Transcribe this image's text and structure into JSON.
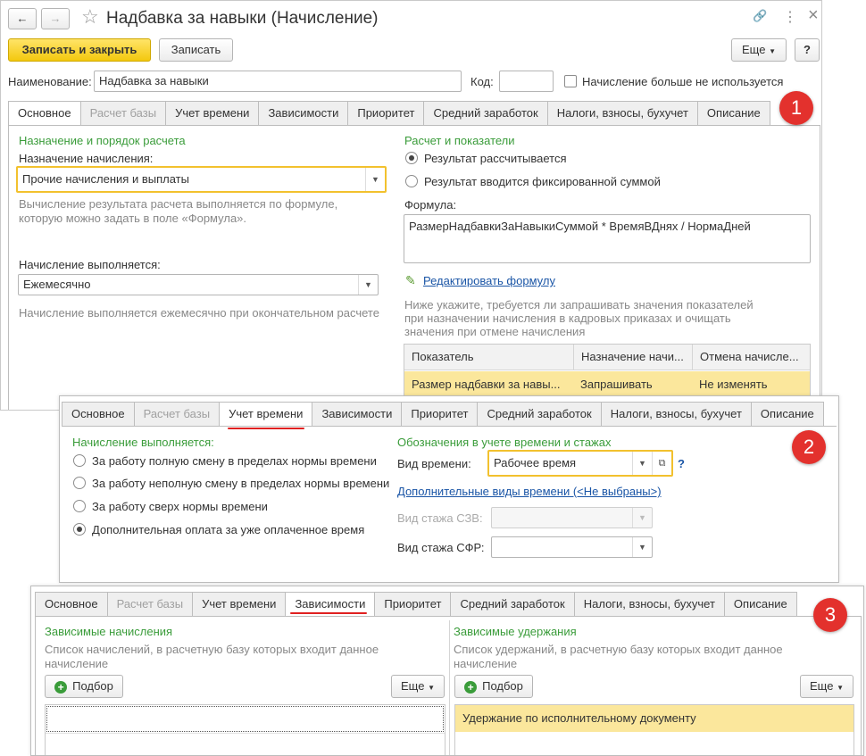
{
  "window": {
    "title": "Надбавка за навыки (Начисление)",
    "back_icon": "←",
    "forward_icon": "→",
    "star_icon": "☆",
    "link_icon": "🔗",
    "menu_icon": "⋮",
    "close_icon": "×"
  },
  "toolbar": {
    "save_close_label": "Записать и закрыть",
    "save_label": "Записать",
    "more_label": "Еще",
    "help_label": "?"
  },
  "header": {
    "name_label": "Наименование:",
    "name_value": "Надбавка за навыки",
    "code_label": "Код:",
    "code_value": "",
    "not_used_label": "Начисление больше не используется"
  },
  "tabs": [
    {
      "label": "Основное"
    },
    {
      "label": "Расчет базы"
    },
    {
      "label": "Учет времени"
    },
    {
      "label": "Зависимости"
    },
    {
      "label": "Приоритет"
    },
    {
      "label": "Средний заработок"
    },
    {
      "label": "Налоги, взносы, бухучет"
    },
    {
      "label": "Описание"
    }
  ],
  "badges": [
    "1",
    "2",
    "3"
  ],
  "main": {
    "left": {
      "section_title": "Назначение и порядок расчета",
      "purpose_label": "Назначение начисления:",
      "purpose_value": "Прочие начисления и выплаты",
      "purpose_hint_line1": "Вычисление результата расчета выполняется по формуле,",
      "purpose_hint_line2": "которую можно задать в поле «Формула».",
      "executed_label": "Начисление выполняется:",
      "executed_value": "Ежемесячно",
      "executed_hint": "Начисление выполняется ежемесячно при окончательном расчете"
    },
    "right": {
      "section_title": "Расчет и показатели",
      "radio_calculated": "Результат рассчитывается",
      "radio_fixed": "Результат вводится фиксированной суммой",
      "formula_label": "Формула:",
      "formula_value": "РазмерНадбавкиЗаНавыкиСуммой * ВремяВДнях / НормаДней",
      "edit_formula_link": "Редактировать формулу",
      "indicators_hint_line1": "Ниже укажите, требуется ли запрашивать значения показателей",
      "indicators_hint_line2": "при назначении начисления в кадровых приказах и очищать",
      "indicators_hint_line3": "значения при отмене начисления",
      "table": {
        "headers": [
          "Показатель",
          "Назначение начи...",
          "Отмена начисле..."
        ],
        "row": [
          "Размер надбавки за навы...",
          "Запрашивать",
          "Не изменять"
        ]
      }
    }
  },
  "time_tab": {
    "left_title": "Начисление выполняется:",
    "options": [
      "За работу полную смену в пределах нормы времени",
      "За работу неполную смену в пределах нормы времени",
      "За работу сверх нормы времени",
      "Дополнительная оплата за уже оплаченное время"
    ],
    "selected_index": 3,
    "right_title": "Обозначения в учете времени и стажах",
    "time_type_label": "Вид времени:",
    "time_type_value": "Рабочее время",
    "help_mark": "?",
    "extra_types_link": "Дополнительные виды времени (<Не выбраны>)",
    "szv_label": "Вид стажа СЗВ:",
    "szv_value": "",
    "sfr_label": "Вид стажа СФР:",
    "sfr_value": ""
  },
  "deps_tab": {
    "left_title": "Зависимые начисления",
    "left_hint_line1": "Список начислений, в расчетную базу которых входит данное",
    "left_hint_line2": "начисление",
    "pick_label": "Подбор",
    "more_label": "Еще",
    "right_title": "Зависимые удержания",
    "right_hint_line1": "Список удержаний, в расчетную базу которых входит данное",
    "right_hint_line2": "начисление",
    "right_row": "Удержание по исполнительному документу"
  },
  "colors": {
    "accent_green": "#3a9c3a",
    "highlight_yellow": "#fbe79c",
    "focus_border": "#f2c12e",
    "badge_red": "#e3312d",
    "underline_red": "#e02020"
  }
}
